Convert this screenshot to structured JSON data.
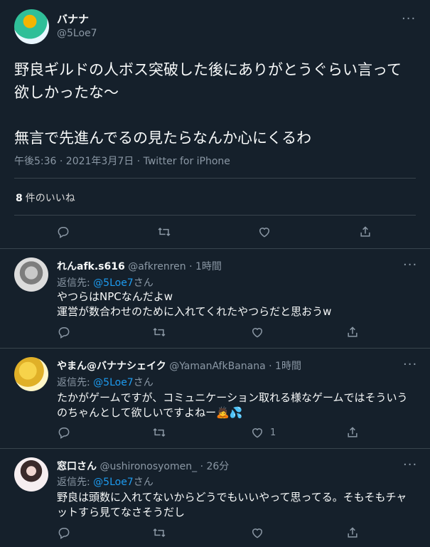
{
  "main_tweet": {
    "display_name": "バナナ",
    "handle": "@5Loe7",
    "text": "野良ギルドの人ボス突破した後にありがとうぐらい言って欲しかったな〜\n\n無言で先進んでるの見たらなんか心にくるわ",
    "meta": "午後5:36 · 2021年3月7日 · Twitter for iPhone",
    "likes_count": "8",
    "likes_label": "件のいいね",
    "more": "···"
  },
  "replies": [
    {
      "display_name": "れんafk.s616",
      "handle": "@afkrenren",
      "time": "· 1時間",
      "reply_prefix": "返信先:",
      "reply_to": "@5Loe7",
      "reply_suffix": "さん",
      "text": "やつらはNPCなんだよw\n運営が数合わせのために入れてくれたやつらだと思おうw",
      "like_count": "",
      "more": "···"
    },
    {
      "display_name": "やまん@バナナシェイク",
      "handle": "@YamanAfkBanana",
      "time": "· 1時間",
      "reply_prefix": "返信先:",
      "reply_to": "@5Loe7",
      "reply_suffix": "さん",
      "text": "たかがゲームですが、コミュニケーション取れる様なゲームではそういうのちゃんとして欲しいですよねー🙇💦",
      "like_count": "1",
      "more": "···"
    },
    {
      "display_name": "窓口さん",
      "handle": "@ushironosyomen_",
      "time": "· 26分",
      "reply_prefix": "返信先:",
      "reply_to": "@5Loe7",
      "reply_suffix": "さん",
      "text": "野良は頭数に入れてないからどうでもいいやって思ってる。そもそもチャットすら見てなさそうだし",
      "like_count": "",
      "more": "···"
    }
  ]
}
